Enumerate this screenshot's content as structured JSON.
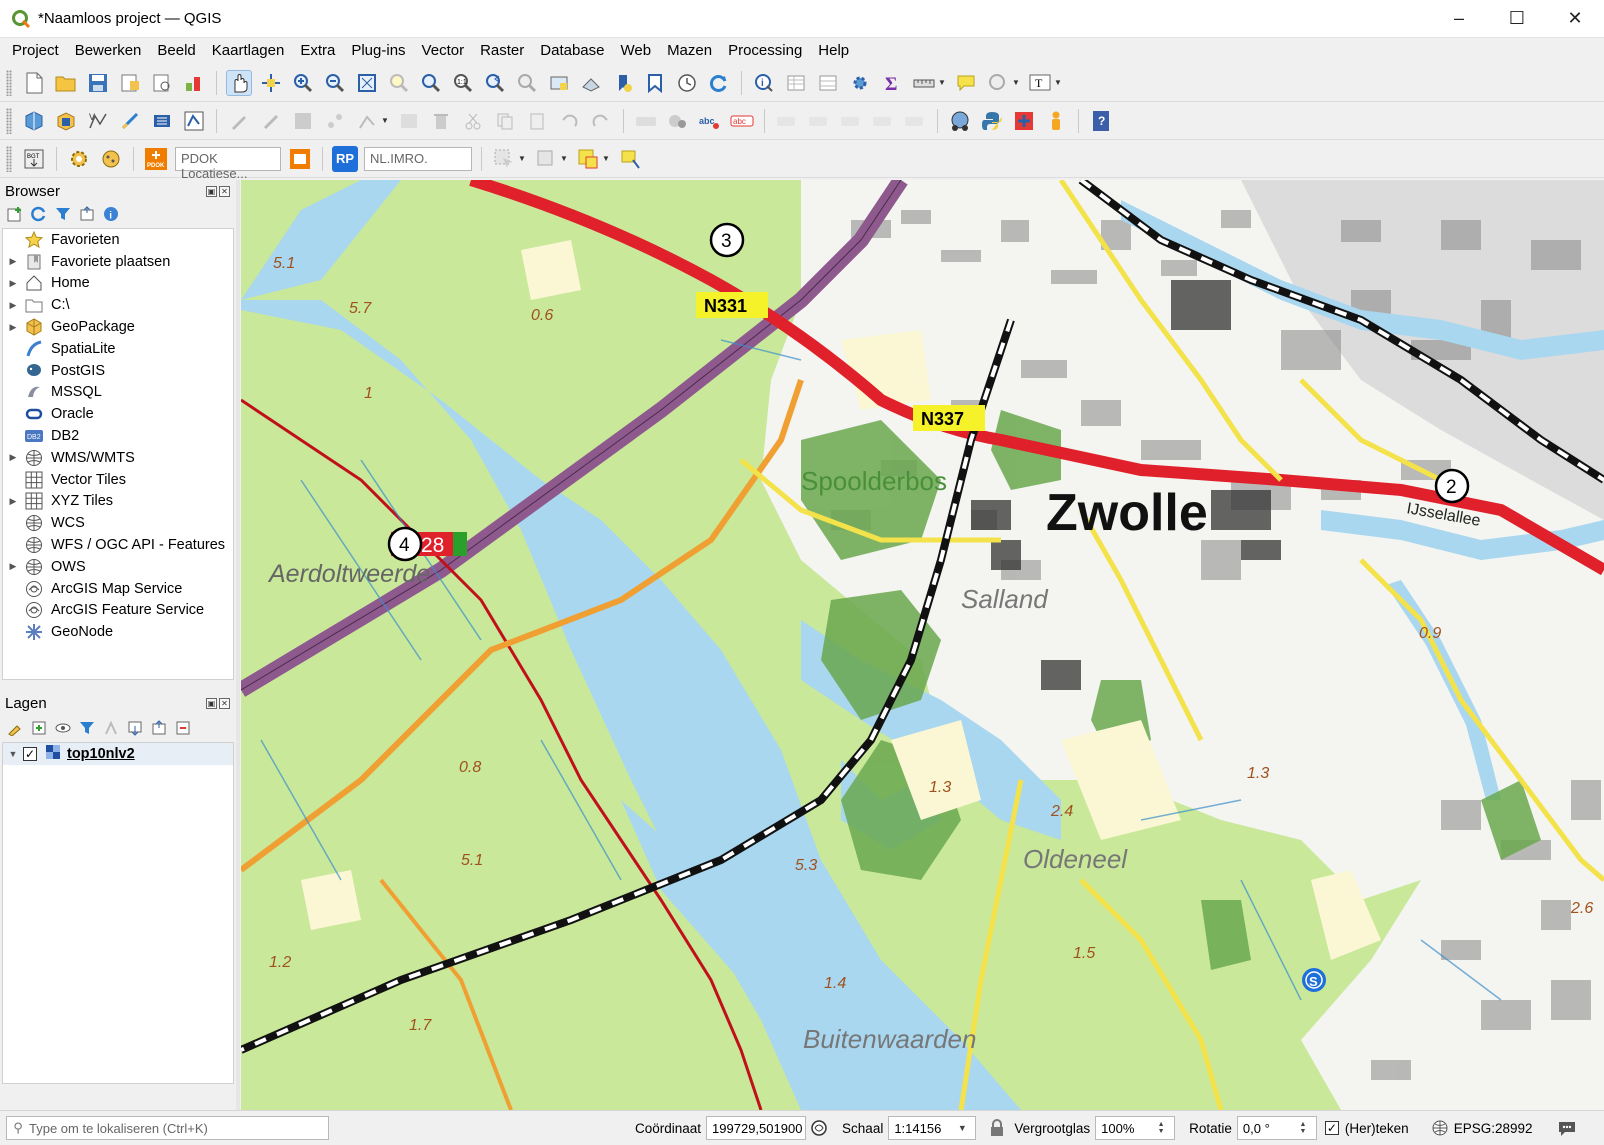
{
  "window": {
    "title": "*Naamloos project — QGIS",
    "controls": [
      "minimize",
      "maximize",
      "close"
    ]
  },
  "menubar": [
    "Project",
    "Bewerken",
    "Beeld",
    "Kaartlagen",
    "Extra",
    "Plug-ins",
    "Vector",
    "Raster",
    "Database",
    "Web",
    "Mazen",
    "Processing",
    "Help"
  ],
  "toolbar3": {
    "pdok_placeholder": "PDOK Locatiese...",
    "rp_label": "RP",
    "imro_placeholder": "NL.IMRO."
  },
  "browser": {
    "title": "Browser",
    "items": [
      {
        "label": "Favorieten",
        "icon": "star-icon",
        "expandable": false
      },
      {
        "label": "Favoriete plaatsen",
        "icon": "bookmark-icon",
        "expandable": true
      },
      {
        "label": "Home",
        "icon": "home-icon",
        "expandable": true
      },
      {
        "label": "C:\\",
        "icon": "folder-icon",
        "expandable": true
      },
      {
        "label": "GeoPackage",
        "icon": "geopackage-icon",
        "expandable": true
      },
      {
        "label": "SpatiaLite",
        "icon": "spatialite-icon",
        "expandable": false
      },
      {
        "label": "PostGIS",
        "icon": "postgis-icon",
        "expandable": false
      },
      {
        "label": "MSSQL",
        "icon": "mssql-icon",
        "expandable": false
      },
      {
        "label": "Oracle",
        "icon": "oracle-icon",
        "expandable": false
      },
      {
        "label": "DB2",
        "icon": "db2-icon",
        "expandable": false
      },
      {
        "label": "WMS/WMTS",
        "icon": "globe-icon",
        "expandable": true
      },
      {
        "label": "Vector Tiles",
        "icon": "grid-icon",
        "expandable": false
      },
      {
        "label": "XYZ Tiles",
        "icon": "grid-icon",
        "expandable": true
      },
      {
        "label": "WCS",
        "icon": "globe-icon",
        "expandable": false
      },
      {
        "label": "WFS / OGC API - Features",
        "icon": "globe-icon",
        "expandable": false
      },
      {
        "label": "OWS",
        "icon": "globe-icon",
        "expandable": true
      },
      {
        "label": "ArcGIS Map Service",
        "icon": "arcgis-icon",
        "expandable": false
      },
      {
        "label": "ArcGIS Feature Service",
        "icon": "arcgis-icon",
        "expandable": false
      },
      {
        "label": "GeoNode",
        "icon": "geonode-icon",
        "expandable": false
      }
    ]
  },
  "layers": {
    "title": "Lagen",
    "items": [
      {
        "label": "top10nlv2",
        "checked": true
      }
    ]
  },
  "map": {
    "labels": {
      "city": "Zwolle",
      "n331": "N331",
      "n337": "N337",
      "road_28": "28",
      "spoolderbos": "Spoolderbos",
      "aerdoltweerde": "Aerdoltweerde",
      "salland": "Salland",
      "oldeneel": "Oldeneel",
      "buitenwaarden": "Buitenwaarden",
      "ijsselallee": "IJsselallee",
      "marker_2": "2",
      "marker_3": "3",
      "marker_4": "4",
      "station_s": "S"
    },
    "depths": [
      "5.1",
      "5.7",
      "0.6",
      "1",
      "0.8",
      "5.1",
      "1.2",
      "1.7",
      "1.4",
      "5.3",
      "1.3",
      "2.4",
      "1.5",
      "1.3",
      "0.9",
      "2.6"
    ],
    "colors": {
      "meadow": "#c9e89a",
      "water": "#a9d7ef",
      "highway": "#e0202a",
      "railway": "#111111",
      "road_yellow": "#f4e24a",
      "road_orange": "#f0a033",
      "motorway_purple": "#8e5a8e",
      "urban": "#ffffff",
      "forest": "#6aa84f"
    }
  },
  "statusbar": {
    "locator_placeholder": "Type om te lokaliseren (Ctrl+K)",
    "coord_label": "Coördinaat",
    "coord_value": "199729,501900",
    "scale_label": "Schaal",
    "scale_value": "1:14156",
    "magnifier_label": "Vergrootglas",
    "magnifier_value": "100%",
    "rotation_label": "Rotatie",
    "rotation_value": "0,0 °",
    "render_label": "(Her)teken",
    "render_checked": true,
    "crs_label": "EPSG:28992"
  }
}
